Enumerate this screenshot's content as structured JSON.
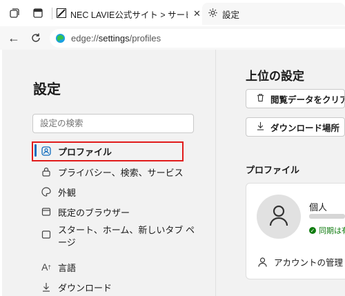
{
  "tabs": [
    {
      "title": "NEC LAVIE公式サイト > サービス&サ",
      "icon": "nec-favicon",
      "active": false
    },
    {
      "title": "設定",
      "icon": "gear-icon",
      "active": true
    }
  ],
  "address": {
    "scheme": "edge://",
    "host": "settings",
    "path": "/profiles"
  },
  "sidebar": {
    "title": "設定",
    "search_placeholder": "設定の検索",
    "items": [
      {
        "label": "プロファイル",
        "icon": "profile-icon",
        "active": true
      },
      {
        "label": "プライバシー、検索、サービス",
        "icon": "lock-icon"
      },
      {
        "label": "外観",
        "icon": "palette-icon"
      },
      {
        "label": "既定のブラウザー",
        "icon": "browser-icon"
      },
      {
        "label": "スタート、ホーム、新しいタブ ページ",
        "icon": "home-icon"
      },
      {
        "label": "言語",
        "icon": "language-icon"
      },
      {
        "label": "ダウンロード",
        "icon": "download-icon"
      }
    ]
  },
  "main": {
    "title": "上位の設定",
    "buttons": [
      {
        "label": "閲覧データをクリア",
        "icon": "trash-icon"
      },
      {
        "label": "ダウンロード場所",
        "icon": "download-icon"
      }
    ],
    "section_title": "プロファイル",
    "profile": {
      "name": "個人",
      "sync_status": "同期は有",
      "account_label": "アカウントの管理"
    }
  },
  "colors": {
    "accent": "#0f6cbd",
    "highlight": "#e11a1a",
    "sync": "#107c10",
    "panel": "#f2f2f2"
  }
}
